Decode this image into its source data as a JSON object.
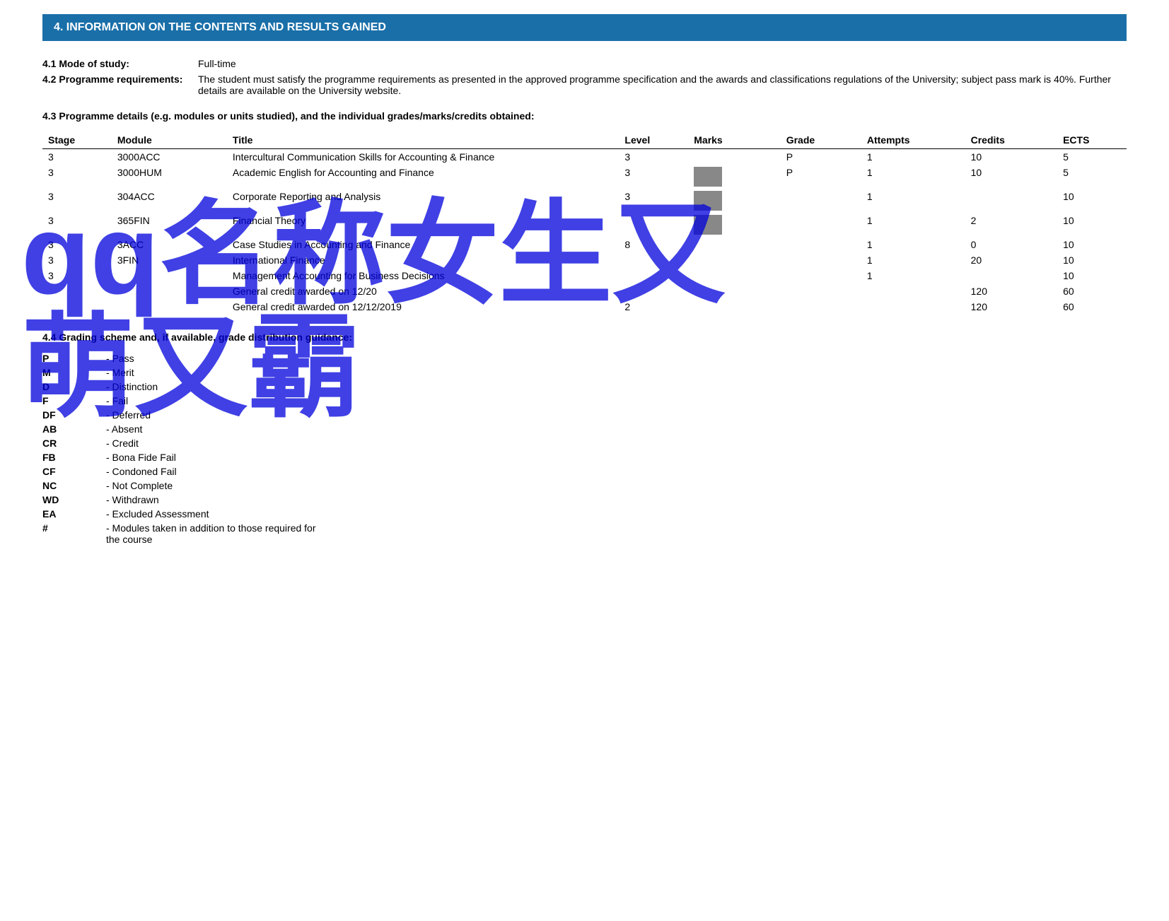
{
  "section": {
    "title": "4. INFORMATION ON THE CONTENTS AND RESULTS GAINED"
  },
  "mode_of_study": {
    "label": "4.1 Mode of study:",
    "value": "Full-time"
  },
  "programme_requirements": {
    "label": "4.2 Programme requirements:",
    "value": "The student must satisfy the programme requirements as presented in the approved programme specification and the awards and classifications regulations of the University; subject pass mark is 40%. Further details are available on the University website."
  },
  "programme_details": {
    "title": "4.3 Programme details (e.g. modules or units studied), and the individual grades/marks/credits obtained:",
    "columns": {
      "stage": "Stage",
      "module": "Module",
      "title": "Title",
      "level": "Level",
      "marks": "Marks",
      "grade": "Grade",
      "attempts": "Attempts",
      "credits": "Credits",
      "ects": "ECTS"
    },
    "rows": [
      {
        "stage": "3",
        "module": "3000ACC",
        "title": "Intercultural Communication Skills for Accounting & Finance",
        "level": "3",
        "marks": "",
        "marks_box": false,
        "grade": "P",
        "attempts": "1",
        "credits": "10",
        "ects": "5"
      },
      {
        "stage": "3",
        "module": "3000HUM",
        "title": "Academic English for Accounting and Finance",
        "level": "3",
        "marks": "",
        "marks_box": true,
        "grade": "P",
        "attempts": "1",
        "credits": "10",
        "ects": "5"
      },
      {
        "stage": "3",
        "module": "304ACC",
        "title": "Corporate Reporting and Analysis",
        "level": "3",
        "marks": "",
        "marks_box": true,
        "grade": "",
        "attempts": "1",
        "credits": "",
        "ects": "10"
      },
      {
        "stage": "3",
        "module": "365FIN",
        "title": "Financial Theory",
        "level": "",
        "marks": "",
        "marks_box": true,
        "grade": "",
        "attempts": "1",
        "credits": "2",
        "ects": "10"
      },
      {
        "stage": "3",
        "module": "3ACC",
        "title": "Case Studies in Accounting and Finance",
        "level": "8",
        "marks": "",
        "marks_box": false,
        "grade": "",
        "attempts": "1",
        "credits": "0",
        "ects": "10"
      },
      {
        "stage": "3",
        "module": "3FIN",
        "title": "International Finance",
        "level": "",
        "marks": "",
        "marks_box": false,
        "grade": "",
        "attempts": "1",
        "credits": "20",
        "ects": "10"
      },
      {
        "stage": "3",
        "module": "",
        "title": "Management Accounting for Business Decisions",
        "level": "",
        "marks": "",
        "marks_box": false,
        "grade": "",
        "attempts": "1",
        "credits": "",
        "ects": "10"
      },
      {
        "stage": "",
        "module": "",
        "title": "General credit awarded on 12/20",
        "level": "",
        "marks": "",
        "marks_box": false,
        "grade": "",
        "attempts": "",
        "credits": "120",
        "ects": "60"
      },
      {
        "stage": "",
        "module": "",
        "title": "General credit awarded on 12/12/2019",
        "level": "2",
        "marks": "",
        "marks_box": false,
        "grade": "",
        "attempts": "",
        "credits": "120",
        "ects": "60"
      }
    ]
  },
  "grading_scheme": {
    "title": "4.4 Grading scheme and, if available, grade distribution guidance:",
    "grades": [
      {
        "code": "P",
        "description": "- Pass"
      },
      {
        "code": "M",
        "description": "- Merit"
      },
      {
        "code": "D",
        "description": "- Distinction"
      },
      {
        "code": "F",
        "description": "- Fail"
      },
      {
        "code": "DF",
        "description": "- Deferred"
      },
      {
        "code": "AB",
        "description": "- Absent"
      },
      {
        "code": "CR",
        "description": "- Credit"
      },
      {
        "code": "FB",
        "description": "- Bona Fide Fail"
      },
      {
        "code": "CF",
        "description": "- Condoned Fail"
      },
      {
        "code": "NC",
        "description": "- Not Complete"
      },
      {
        "code": "WD",
        "description": "- Withdrawn"
      },
      {
        "code": "EA",
        "description": "- Excluded Assessment"
      },
      {
        "code": "#",
        "description": "- Modules taken in addition to those required for the course"
      }
    ]
  },
  "watermark": {
    "line1": "qq名称女生又",
    "line2": "萌又霸"
  }
}
